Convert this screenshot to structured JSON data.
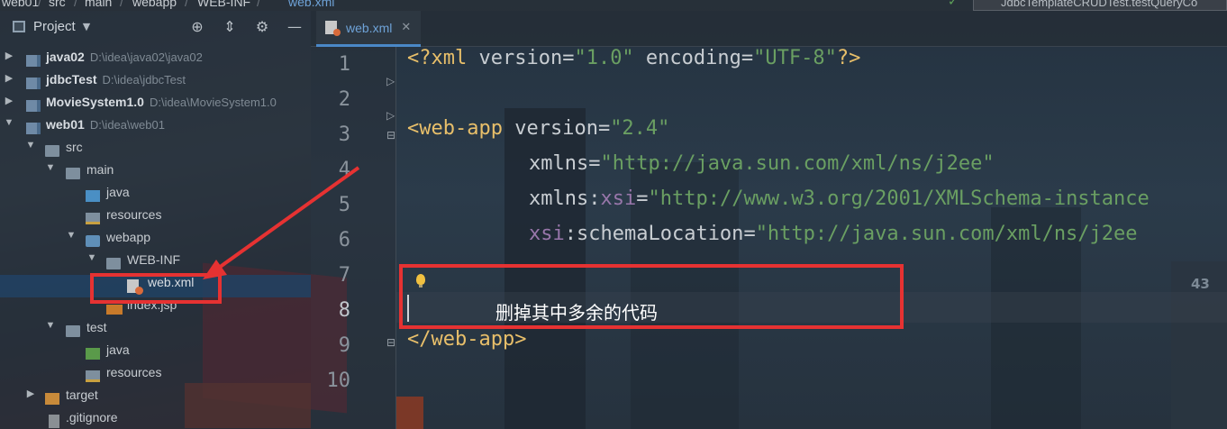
{
  "breadcrumb": {
    "items": [
      "web01",
      "src",
      "main",
      "webapp",
      "WEB-INF",
      "web.xml"
    ]
  },
  "run_config": {
    "label": "JdbcTemplateCRUDTest.testQueryCo"
  },
  "project_panel": {
    "title": "Project",
    "tools": [
      "target-icon",
      "collapse-icon",
      "gear-icon",
      "minimize-icon"
    ]
  },
  "tree": {
    "items": [
      {
        "label": "java02",
        "path": "D:\\idea\\java02\\java02"
      },
      {
        "label": "jdbcTest",
        "path": "D:\\idea\\jdbcTest"
      },
      {
        "label": "MovieSystem1.0",
        "path": "D:\\idea\\MovieSystem1.0"
      },
      {
        "label": "web01",
        "path": "D:\\idea\\web01"
      },
      {
        "label": "src"
      },
      {
        "label": "main"
      },
      {
        "label": "java"
      },
      {
        "label": "resources"
      },
      {
        "label": "webapp"
      },
      {
        "label": "WEB-INF"
      },
      {
        "label": "web.xml"
      },
      {
        "label": "index.jsp"
      },
      {
        "label": "test"
      },
      {
        "label": "java"
      },
      {
        "label": "resources"
      },
      {
        "label": "target"
      },
      {
        "label": ".gitignore"
      }
    ]
  },
  "editor": {
    "tab_label": "web.xml",
    "line_numbers": [
      "1",
      "2",
      "3",
      "4",
      "5",
      "6",
      "7",
      "8",
      "9",
      "10"
    ],
    "code": {
      "l1_open": "<?xml ",
      "l1_version_attr": "version",
      "l1_version_val": "\"1.0\"",
      "l1_encoding_attr": " encoding",
      "l1_encoding_val": "\"UTF-8\"",
      "l1_close": "?>",
      "l3_tag": "<web-app ",
      "l3_attr": "version",
      "l3_val": "\"2.4\"",
      "l4_attr": "xmlns",
      "l4_val": "\"http://java.sun.com/xml/ns/j2ee\"",
      "l5_attr": "xmlns:",
      "l5_ns": "xsi",
      "l5_val": "\"http://www.w3.org/2001/XMLSchema-instance",
      "l6_ns": "xsi",
      "l6_attr": ":schemaLocation",
      "l6_val": "\"http://java.sun.com/xml/ns/j2ee",
      "l9_tag": "</web-app>",
      "eq": "="
    }
  },
  "annotation": {
    "text": "删掉其中多余的代码",
    "color": "#e63232"
  },
  "background": {
    "number": "43"
  },
  "colors": {
    "accent_blue": "#6ea2d7",
    "xml_tag": "#e8bf6a",
    "xml_string": "#6a9f62",
    "xml_ns": "#9876aa",
    "annotation_red": "#e63232"
  }
}
